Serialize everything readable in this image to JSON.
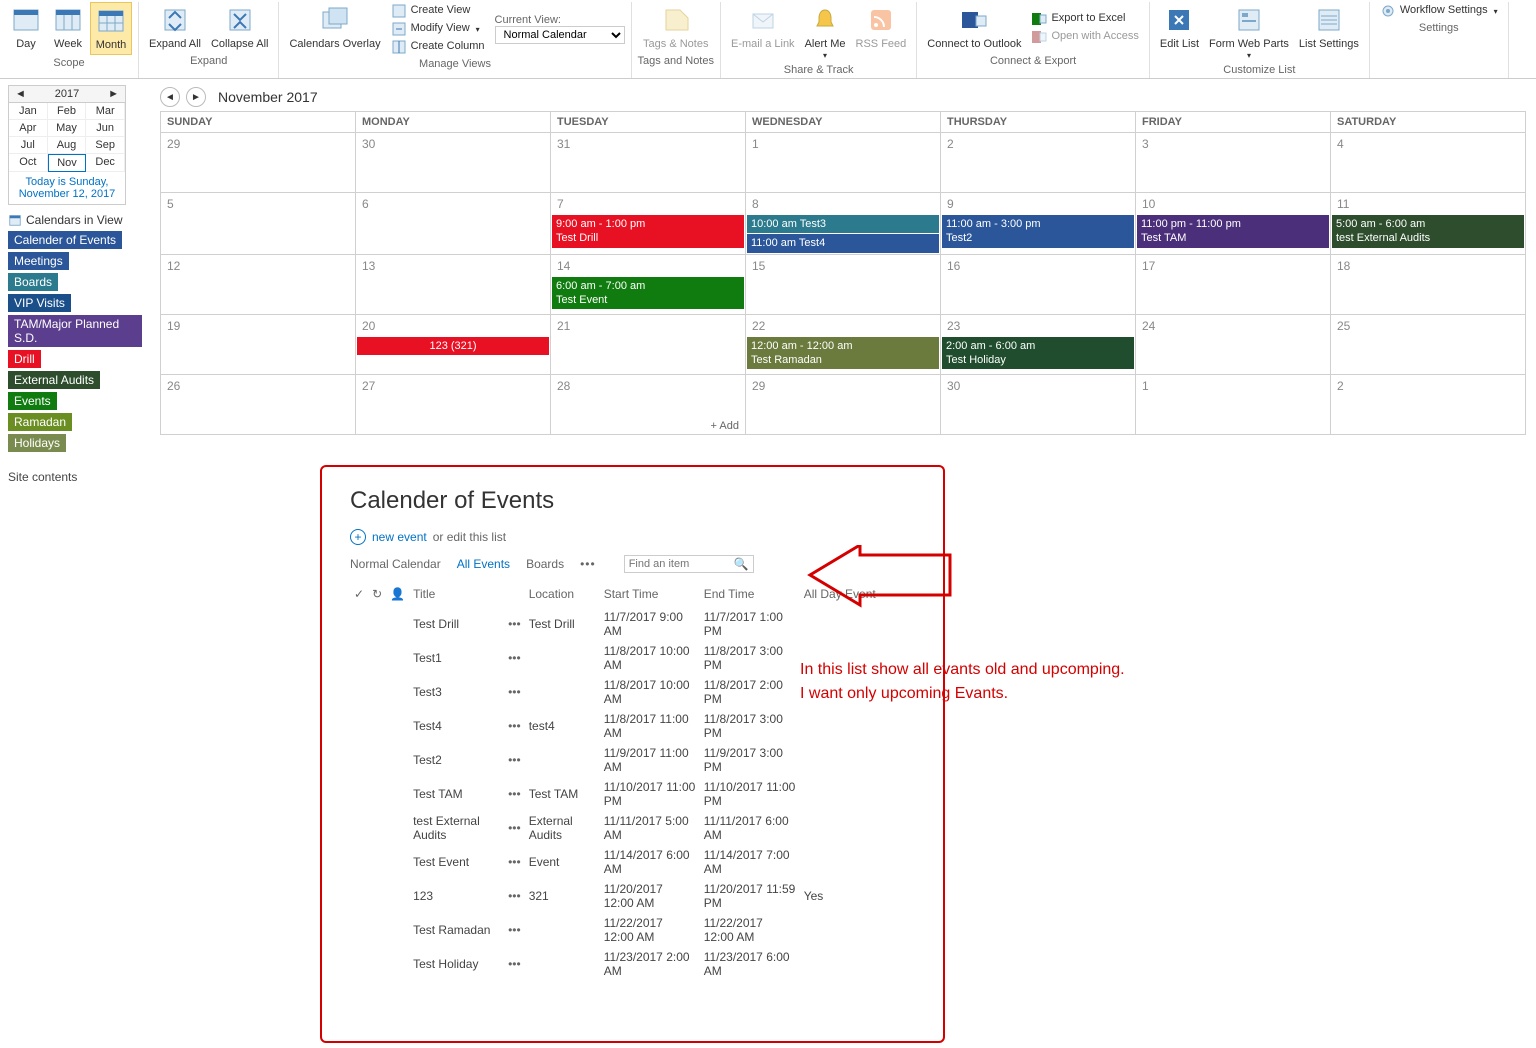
{
  "ribbon": {
    "scope": {
      "label": "Scope",
      "day": "Day",
      "week": "Week",
      "month": "Month"
    },
    "expand": {
      "label": "Expand",
      "expandAll": "Expand\nAll",
      "collapseAll": "Collapse\nAll"
    },
    "manage": {
      "label": "Manage Views",
      "calOverlay": "Calendars\nOverlay",
      "createView": "Create View",
      "modifyView": "Modify View",
      "createColumn": "Create Column",
      "currentView": "Current View:",
      "selected": "Normal Calendar"
    },
    "tags": {
      "label": "Tags and Notes",
      "btn": "Tags &\nNotes"
    },
    "share": {
      "label": "Share & Track",
      "email": "E-mail a\nLink",
      "alert": "Alert\nMe",
      "rss": "RSS\nFeed"
    },
    "connect": {
      "label": "Connect & Export",
      "outlook": "Connect to\nOutlook",
      "excel": "Export to Excel",
      "access": "Open with Access"
    },
    "customize": {
      "label": "Customize List",
      "edit": "Edit\nList",
      "form": "Form Web\nParts",
      "listset": "List\nSettings"
    },
    "settings": {
      "label": "Settings",
      "workflow": "Workflow Settings"
    }
  },
  "datepick": {
    "year": "2017",
    "months": [
      "Jan",
      "Feb",
      "Mar",
      "Apr",
      "May",
      "Jun",
      "Jul",
      "Aug",
      "Sep",
      "Oct",
      "Nov",
      "Dec"
    ],
    "current": "Nov",
    "today": "Today is Sunday, November 12, 2017"
  },
  "calInView": "Calendars in View",
  "calendars": [
    {
      "label": "Calender of Events",
      "cls": "c-blue"
    },
    {
      "label": "Meetings",
      "cls": "c-blue"
    },
    {
      "label": "Boards",
      "cls": "c-teal"
    },
    {
      "label": "VIP Visits",
      "cls": "c-navy"
    },
    {
      "label": "TAM/Major Planned S.D.",
      "cls": "c-purple"
    },
    {
      "label": "Drill",
      "cls": "c-red"
    },
    {
      "label": "External Audits",
      "cls": "c-dgreen"
    },
    {
      "label": "Events",
      "cls": "c-green"
    },
    {
      "label": "Ramadan",
      "cls": "c-olive"
    },
    {
      "label": "Holidays",
      "cls": "c-olive2"
    }
  ],
  "siteContents": "Site contents",
  "calHeader": "November 2017",
  "days": [
    "SUNDAY",
    "MONDAY",
    "TUESDAY",
    "WEDNESDAY",
    "THURSDAY",
    "FRIDAY",
    "SATURDAY"
  ],
  "weeks": [
    [
      {
        "n": "29"
      },
      {
        "n": "30"
      },
      {
        "n": "31"
      },
      {
        "n": "1"
      },
      {
        "n": "2"
      },
      {
        "n": "3"
      },
      {
        "n": "4"
      }
    ],
    [
      {
        "n": "5"
      },
      {
        "n": "6"
      },
      {
        "n": "7",
        "e": [
          {
            "t": "9:00 am - 1:00 pm",
            "ttl": "Test Drill",
            "c": "#e81123"
          }
        ]
      },
      {
        "n": "8",
        "e": [
          {
            "t": "10:00 am Test3",
            "c": "#2b7a8d"
          },
          {
            "t": "11:00 am Test4",
            "c": "#2b579a"
          }
        ]
      },
      {
        "n": "9",
        "e": [
          {
            "t": "11:00 am - 3:00 pm",
            "ttl": "Test2",
            "c": "#2b579a"
          }
        ]
      },
      {
        "n": "10",
        "e": [
          {
            "t": "11:00 pm - 11:00 pm",
            "ttl": "Test TAM",
            "c": "#4b2f7a"
          }
        ]
      },
      {
        "n": "11",
        "e": [
          {
            "t": "5:00 am - 6:00 am",
            "ttl": "test External Audits",
            "c": "#2d4d2d"
          }
        ]
      }
    ],
    [
      {
        "n": "12"
      },
      {
        "n": "13"
      },
      {
        "n": "14",
        "e": [
          {
            "t": "6:00 am - 7:00 am",
            "ttl": "Test Event",
            "c": "#107c10"
          }
        ]
      },
      {
        "n": "15"
      },
      {
        "n": "16"
      },
      {
        "n": "17"
      },
      {
        "n": "18"
      }
    ],
    [
      {
        "n": "19"
      },
      {
        "n": "20",
        "e": [
          {
            "t": "123 (321)",
            "c": "#e81123",
            "center": true
          }
        ]
      },
      {
        "n": "21"
      },
      {
        "n": "22",
        "e": [
          {
            "t": "12:00 am - 12:00 am",
            "ttl": "Test Ramadan",
            "c": "#6b7a3d"
          }
        ]
      },
      {
        "n": "23",
        "e": [
          {
            "t": "2:00 am - 6:00 am",
            "ttl": "Test Holiday",
            "c": "#1f4d2d"
          }
        ]
      },
      {
        "n": "24"
      },
      {
        "n": "25"
      }
    ],
    [
      {
        "n": "26"
      },
      {
        "n": "27"
      },
      {
        "n": "28",
        "add": true
      },
      {
        "n": "29"
      },
      {
        "n": "30"
      },
      {
        "n": "1"
      },
      {
        "n": "2"
      }
    ]
  ],
  "addLabel": "Add",
  "list": {
    "title": "Calender of Events",
    "newEvent": "new event",
    "orEdit": "or edit this list",
    "view1": "Normal Calendar",
    "view2": "All Events",
    "view3": "Boards",
    "find": "Find an item",
    "cols": {
      "title": "Title",
      "loc": "Location",
      "start": "Start Time",
      "end": "End Time",
      "allday": "All Day Event"
    },
    "rows": [
      {
        "title": "Test Drill",
        "loc": "Test Drill",
        "start": "11/7/2017 9:00 AM",
        "end": "11/7/2017 1:00 PM",
        "allday": ""
      },
      {
        "title": "Test1",
        "loc": "",
        "start": "11/8/2017 10:00 AM",
        "end": "11/8/2017 3:00 PM",
        "allday": ""
      },
      {
        "title": "Test3",
        "loc": "",
        "start": "11/8/2017 10:00 AM",
        "end": "11/8/2017 2:00 PM",
        "allday": ""
      },
      {
        "title": "Test4",
        "loc": "test4",
        "start": "11/8/2017 11:00 AM",
        "end": "11/8/2017 3:00 PM",
        "allday": ""
      },
      {
        "title": "Test2",
        "loc": "",
        "start": "11/9/2017 11:00 AM",
        "end": "11/9/2017 3:00 PM",
        "allday": ""
      },
      {
        "title": "Test TAM",
        "loc": "Test TAM",
        "start": "11/10/2017 11:00 PM",
        "end": "11/10/2017 11:00 PM",
        "allday": ""
      },
      {
        "title": "test External Audits",
        "loc": "External Audits",
        "start": "11/11/2017 5:00 AM",
        "end": "11/11/2017 6:00 AM",
        "allday": ""
      },
      {
        "title": "Test Event",
        "loc": "Event",
        "start": "11/14/2017 6:00 AM",
        "end": "11/14/2017 7:00 AM",
        "allday": ""
      },
      {
        "title": "123",
        "loc": "321",
        "start": "11/20/2017 12:00 AM",
        "end": "11/20/2017 11:59 PM",
        "allday": "Yes"
      },
      {
        "title": "Test Ramadan",
        "loc": "",
        "start": "11/22/2017 12:00 AM",
        "end": "11/22/2017 12:00 AM",
        "allday": ""
      },
      {
        "title": "Test Holiday",
        "loc": "",
        "start": "11/23/2017 2:00 AM",
        "end": "11/23/2017 6:00 AM",
        "allday": ""
      }
    ]
  },
  "annotation": {
    "l1": "In this list show all evants old and upcomping.",
    "l2": " I want only upcoming Evants."
  }
}
